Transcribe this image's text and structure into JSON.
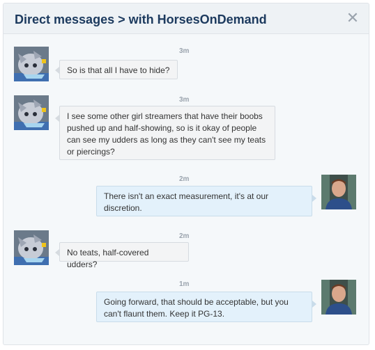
{
  "header": {
    "title": "Direct messages > with HorsesOnDemand",
    "close_icon": "close-icon"
  },
  "colors": {
    "title": "#1c3a5e",
    "incoming_bubble": "#f3f4f5",
    "outgoing_bubble": "#e3f1fb"
  },
  "messages": [
    {
      "direction": "incoming",
      "time": "3m",
      "text": "So is that all I have to hide?"
    },
    {
      "direction": "incoming",
      "time": "3m",
      "text": "I see some other girl streamers that have their boobs pushed up and half-showing, so is it okay of people can see my udders as long as they can't see my teats or piercings?"
    },
    {
      "direction": "outgoing",
      "time": "2m",
      "text": "There isn't an exact measurement, it's at our discretion."
    },
    {
      "direction": "incoming",
      "time": "2m",
      "text": "No teats, half-covered udders?"
    },
    {
      "direction": "outgoing",
      "time": "1m",
      "text": "Going forward, that should be acceptable, but you can't flaunt them. Keep it PG-13."
    }
  ]
}
